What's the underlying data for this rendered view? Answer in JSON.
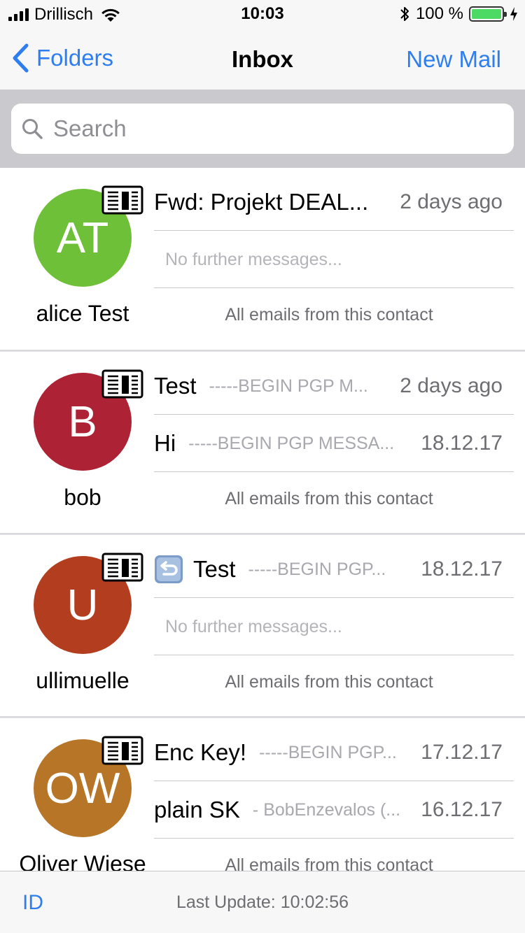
{
  "status_bar": {
    "carrier": "Drillisch",
    "time": "10:03",
    "battery_pct": "100 %"
  },
  "nav": {
    "back_label": "Folders",
    "title": "Inbox",
    "right_label": "New Mail"
  },
  "search": {
    "placeholder": "Search"
  },
  "contacts": [
    {
      "initials": "AT",
      "name": "alice Test",
      "color": "#6ec038",
      "messages": [
        {
          "subject": "Fwd: Projekt DEAL...",
          "preview": "",
          "date": "2 days ago"
        }
      ],
      "no_further": "No further messages...",
      "all_emails": "All emails from this contact"
    },
    {
      "initials": "B",
      "name": "bob",
      "color": "#ad2234",
      "messages": [
        {
          "subject": "Test",
          "preview": "-----BEGIN PGP M...",
          "date": "2 days ago"
        },
        {
          "subject": "Hi",
          "preview": "-----BEGIN PGP MESSA...",
          "date": "18.12.17"
        }
      ],
      "all_emails": "All emails from this contact"
    },
    {
      "initials": "U",
      "name": "ullimuelle",
      "color": "#b33e1f",
      "messages": [
        {
          "subject": "Test",
          "preview": "-----BEGIN PGP...",
          "date": "18.12.17",
          "icon": "reply-icon"
        }
      ],
      "no_further": "No further messages...",
      "all_emails": "All emails from this contact"
    },
    {
      "initials": "OW",
      "name": "Oliver Wiese",
      "color": "#b77527",
      "messages": [
        {
          "subject": "Enc Key!",
          "preview": "-----BEGIN PGP...",
          "date": "17.12.17"
        },
        {
          "subject": "plain SK",
          "preview": "- BobEnzevalos (...",
          "date": "16.12.17"
        }
      ],
      "all_emails": "All emails from this contact"
    }
  ],
  "bottom_bar": {
    "id_label": "ID",
    "last_update": "Last Update: 10:02:56"
  },
  "colors": {
    "accent": "#2f7ef0",
    "battery": "#4cd964"
  }
}
